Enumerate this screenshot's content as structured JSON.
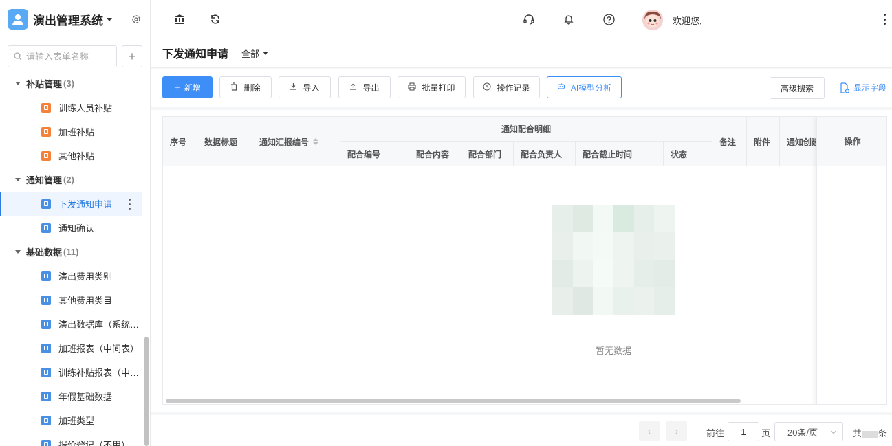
{
  "sidebar": {
    "app_title": "演出管理系统",
    "search_placeholder": "请输入表单名称",
    "add_label": "+",
    "groups": [
      {
        "label": "补贴管理",
        "count": "(3)",
        "items": [
          "训练人员补贴",
          "加班补贴",
          "其他补贴"
        ]
      },
      {
        "label": "通知管理",
        "count": "(2)",
        "items": [
          "下发通知申请",
          "通知确认"
        ]
      },
      {
        "label": "基础数据",
        "count": "(11)",
        "items": [
          "演出费用类别",
          "其他费用类目",
          "演出数据库（系统…",
          "加班报表（中间表）",
          "训练补贴报表（中…",
          "年假基础数据",
          "加班类型",
          "报价登记（不用）"
        ]
      }
    ],
    "active_item": "下发通知申请"
  },
  "topbar": {
    "welcome": "欢迎您,"
  },
  "page": {
    "title": "下发通知申请",
    "filter": "全部"
  },
  "toolbar": {
    "add": "新增",
    "delete": "删除",
    "import": "导入",
    "export": "导出",
    "batch_print": "批量打印",
    "history": "操作记录",
    "ai": "AI模型分析",
    "advanced_search": "高级搜索",
    "show_fields": "显示字段"
  },
  "table": {
    "columns": {
      "seq": "序号",
      "title": "数据标题",
      "report_no": "通知汇报编号",
      "group": "通知配合明细",
      "sub": [
        "配合编号",
        "配合内容",
        "配合部门",
        "配合负责人",
        "配合截止时间",
        "状态"
      ],
      "remark": "备注",
      "attachment": "附件",
      "created": "通知创建",
      "actions": "操作"
    },
    "empty_text": "暂无数据"
  },
  "pagination": {
    "goto": "前往",
    "page_value": "1",
    "page_unit": "页",
    "page_size": "20条/页",
    "total_prefix": "共",
    "total_suffix": "条"
  },
  "colors": {
    "primary": "#3e8ef7",
    "orange_icon": "#f5823a",
    "blue_icon": "#4a90e2"
  }
}
